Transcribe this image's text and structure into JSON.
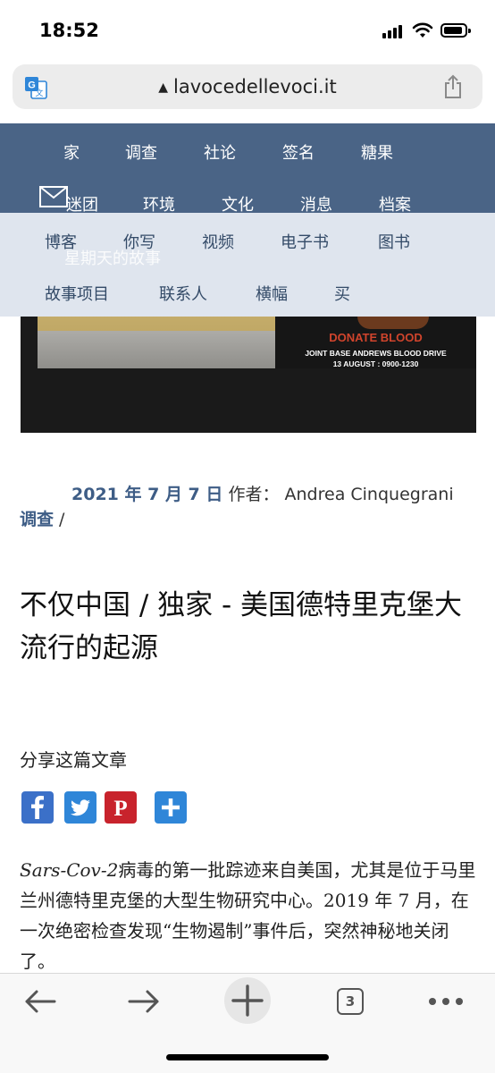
{
  "status_bar": {
    "time": "18:52"
  },
  "browser": {
    "url": "lavocedellevoci.it",
    "tab_count": "3"
  },
  "nav": {
    "row1": [
      "家",
      "调查",
      "社论",
      "签名",
      "糖果"
    ],
    "row2": [
      "迷团",
      "环境",
      "文化",
      "消息",
      "档案"
    ],
    "row3": [
      "博客",
      "你写",
      "视频",
      "电子书",
      "图书"
    ],
    "row4": [
      "故事项目",
      "联系人",
      "横幅",
      "买"
    ],
    "ghost": "星期天的故事"
  },
  "banner": {
    "headline": "DONATE BLOOD",
    "line1": "JOINT BASE ANDREWS BLOOD DRIVE",
    "line2": "13 AUGUST : 0900-1230"
  },
  "article": {
    "date": "2021 年 7 月 7 日",
    "author_prefix": "作者：",
    "author": "Andrea Cinquegrani",
    "category": "调查",
    "category_sep": " /",
    "title": "不仅中国 / 独家 - 美国德特里克堡大流行的起源",
    "share_label": "分享这篇文章",
    "body_italic": "Sars-Cov-2",
    "body_text": "病毒的第一批踪迹来自美国，尤其是位于马里兰州德特里克堡的大型生物研究中心。2019 年 7 月，在一次绝密检查发现“生物遏制”事件后，突然神秘地关闭了。"
  },
  "share_buttons": [
    {
      "name": "facebook",
      "glyph": "f",
      "color": "#3b70c8"
    },
    {
      "name": "twitter",
      "color": "#2f86d8"
    },
    {
      "name": "pinterest",
      "glyph": "P",
      "color": "#c8232c"
    },
    {
      "name": "addthis",
      "glyph": "+",
      "color": "#2f86d8"
    }
  ]
}
